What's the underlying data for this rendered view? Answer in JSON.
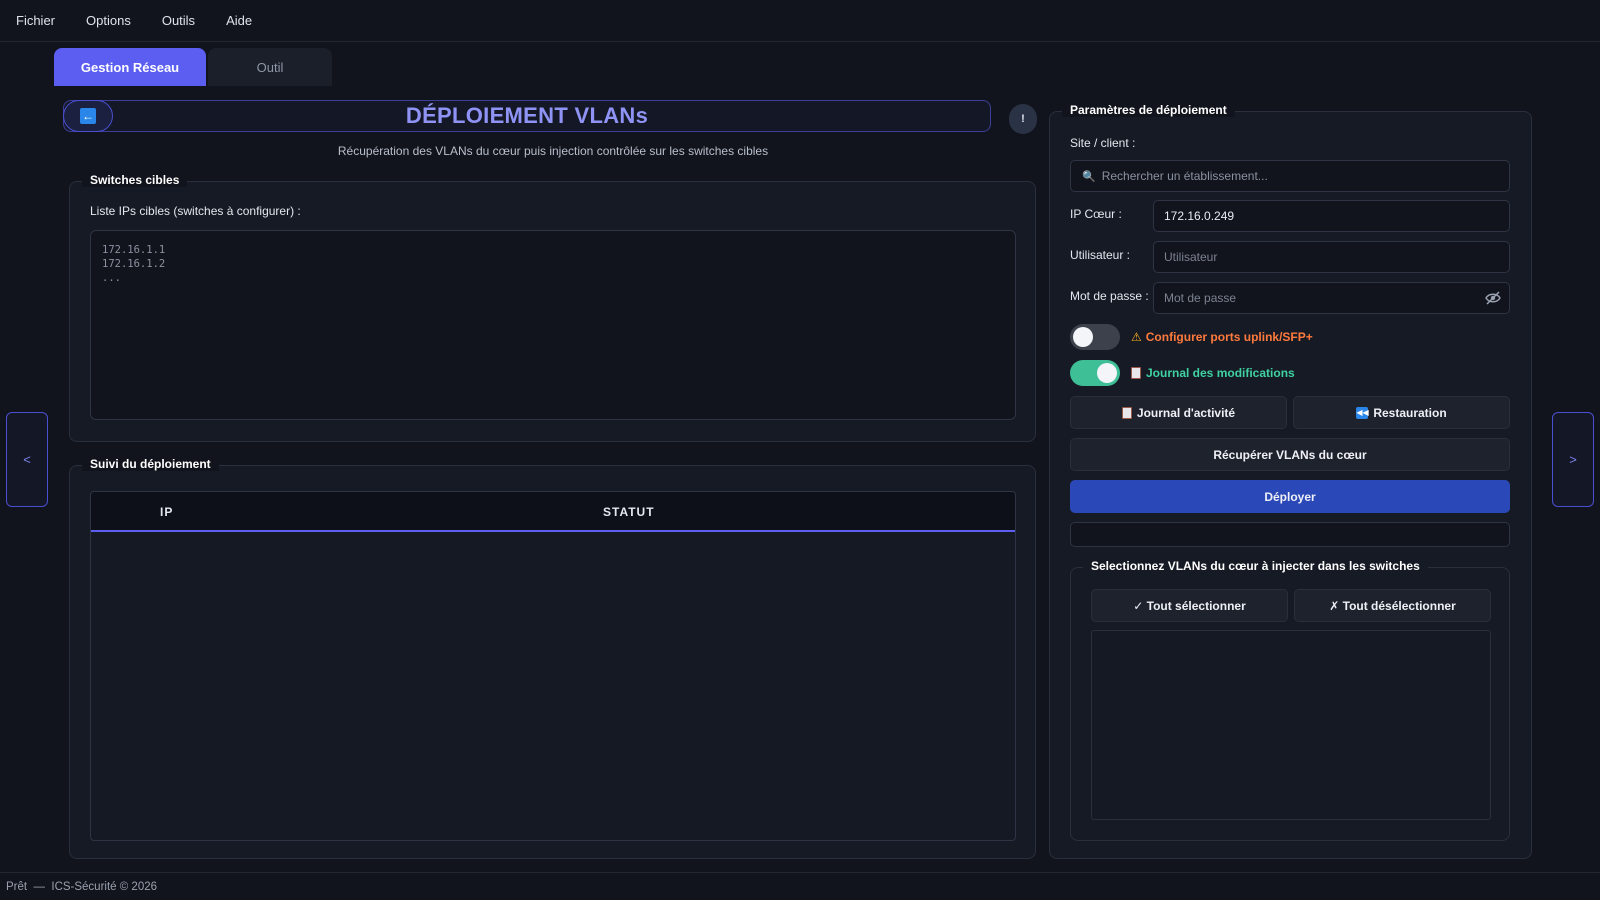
{
  "menu": [
    "Fichier",
    "Options",
    "Outils",
    "Aide"
  ],
  "tabs": {
    "active": "Gestion Réseau",
    "inactive": "Outil"
  },
  "header": {
    "back_icon": "arrow-left-icon",
    "title": "DÉPLOIEMENT VLANs",
    "help_label": "!",
    "subtitle": "Récupération des VLANs du cœur puis injection contrôlée sur les switches cibles"
  },
  "switches": {
    "title": "Switches cibles",
    "label": "Liste IPs cibles (switches à configurer) :",
    "placeholder": "172.16.1.1\n172.16.1.2\n..."
  },
  "tracking": {
    "title": "Suivi du déploiement",
    "columns": [
      "IP",
      "STATUT"
    ]
  },
  "params": {
    "title": "Paramètres de déploiement",
    "site_label": "Site / client :",
    "search_icon": "🔍",
    "search_placeholder": "Rechercher un établissement...",
    "ip_label": "IP Cœur :",
    "ip_value": "172.16.0.249",
    "user_label": "Utilisateur :",
    "user_placeholder": "Utilisateur",
    "password_label": "Mot de passe :",
    "password_placeholder": "Mot de passe",
    "uplink_toggle": {
      "label": "Configurer ports uplink/SFP+",
      "on": false,
      "color": "#ff7a3d"
    },
    "journal_toggle": {
      "label": "Journal des modifications",
      "on": true,
      "color": "#3fd1a2"
    },
    "activity_button": "Journal d'activité",
    "restore_button": "Restauration",
    "fetch_button": "Récupérer VLANs du cœur",
    "deploy_button": "Déployer"
  },
  "vlans": {
    "title": "Selectionnez VLANs du cœur à injecter dans les switches",
    "select_all": "✓ Tout sélectionner",
    "deselect_all": "✗ Tout désélectionner"
  },
  "nav": {
    "prev": "<",
    "next": ">"
  },
  "status": "Prêt  —  ICS-Sécurité © 2026"
}
